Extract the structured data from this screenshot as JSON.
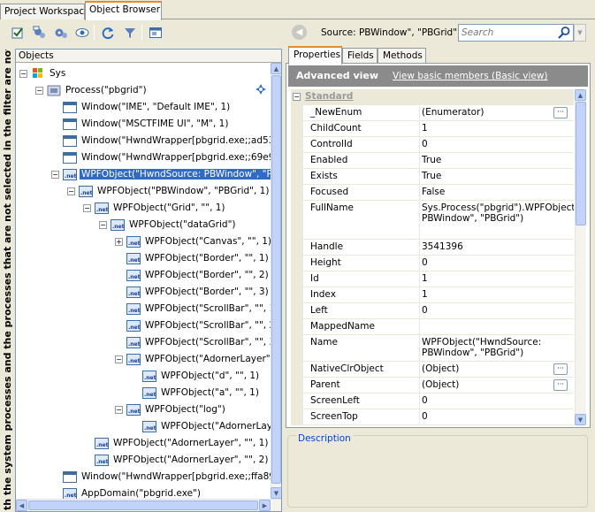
{
  "top_tabs": [
    {
      "label": "Project Workspace",
      "active": false
    },
    {
      "label": "Object Browser",
      "active": true
    }
  ],
  "toolbar": {
    "icons": [
      "checkbox-icon",
      "processes-icon",
      "gears-icon",
      "eye-icon",
      "refresh-icon",
      "filter-icon",
      "window-icon"
    ]
  },
  "source": {
    "label": "Source: PBWindow\", \"PBGrid\")"
  },
  "search": {
    "placeholder": "Search"
  },
  "side_text": "th the system processes and the processes that are not selected in the filter are not displayed",
  "objects_header": "Objects",
  "tree": [
    {
      "label": "Sys",
      "icon": "sys-icon",
      "expander": "-"
    },
    {
      "label": "Process(\"pbgrid\")",
      "icon": "process-icon",
      "expander": "-"
    },
    {
      "label": "Window(\"IME\", \"Default IME\", 1)",
      "icon": "window-icon",
      "expander": ""
    },
    {
      "label": "Window(\"MSCTFIME UI\", \"M\", 1)",
      "icon": "window-icon",
      "expander": ""
    },
    {
      "label": "Window(\"HwndWrapper[pbgrid.exe;;ad53e",
      "icon": "window-icon",
      "expander": ""
    },
    {
      "label": "Window(\"HwndWrapper[pbgrid.exe;;69e90",
      "icon": "window-icon",
      "expander": ""
    },
    {
      "label": "WPFObject(\"HwndSource: PBWindow\", \"PB",
      "icon": "net-icon",
      "expander": "-",
      "selected": true
    },
    {
      "label": "WPFObject(\"PBWindow\", \"PBGrid\", 1)",
      "icon": "net-icon",
      "expander": "-"
    },
    {
      "label": "WPFObject(\"Grid\", \"\", 1)",
      "icon": "net-icon",
      "expander": "-"
    },
    {
      "label": "WPFObject(\"dataGrid\")",
      "icon": "net-icon",
      "expander": "-"
    },
    {
      "label": "WPFObject(\"Canvas\", \"\", 1)",
      "icon": "net-icon",
      "expander": "+"
    },
    {
      "label": "WPFObject(\"Border\", \"\", 1)",
      "icon": "net-icon",
      "expander": ""
    },
    {
      "label": "WPFObject(\"Border\", \"\", 2)",
      "icon": "net-icon",
      "expander": ""
    },
    {
      "label": "WPFObject(\"Border\", \"\", 3)",
      "icon": "net-icon",
      "expander": ""
    },
    {
      "label": "WPFObject(\"ScrollBar\", \"\", 1",
      "icon": "net-icon",
      "expander": ""
    },
    {
      "label": "WPFObject(\"ScrollBar\", \"\", 2",
      "icon": "net-icon",
      "expander": ""
    },
    {
      "label": "WPFObject(\"ScrollBar\", \"\", 3",
      "icon": "net-icon",
      "expander": ""
    },
    {
      "label": "WPFObject(\"AdornerLayer\"",
      "icon": "net-icon",
      "expander": "-"
    },
    {
      "label": "WPFObject(\"d\", \"\", 1)",
      "icon": "net-icon",
      "expander": ""
    },
    {
      "label": "WPFObject(\"a\", \"\", 1)",
      "icon": "net-icon",
      "expander": ""
    },
    {
      "label": "WPFObject(\"log\")",
      "icon": "net-icon",
      "expander": "-"
    },
    {
      "label": "WPFObject(\"AdornerLayer\"",
      "icon": "net-icon",
      "expander": ""
    },
    {
      "label": "WPFObject(\"AdornerLayer\", \"\", 1)",
      "icon": "net-icon",
      "expander": ""
    },
    {
      "label": "WPFObject(\"AdornerLayer\", \"\", 2)",
      "icon": "net-icon",
      "expander": ""
    },
    {
      "label": "Window(\"HwndWrapper[pbgrid.exe;;ffa89c",
      "icon": "window-icon",
      "expander": ""
    },
    {
      "label": "AppDomain(\"pbgrid.exe\")",
      "icon": "net-icon",
      "expander": ""
    }
  ],
  "prop_tabs": [
    {
      "label": "Properties",
      "active": true
    },
    {
      "label": "Fields",
      "active": false
    },
    {
      "label": "Methods",
      "active": false
    }
  ],
  "advanced": {
    "title": "Advanced view",
    "link": "View basic members (Basic view)"
  },
  "category": "Standard",
  "properties": [
    {
      "name": "_NewEnum",
      "value": "(Enumerator)",
      "button": true
    },
    {
      "name": "ChildCount",
      "value": "1",
      "button": false
    },
    {
      "name": "ControlId",
      "value": "0",
      "button": false
    },
    {
      "name": "Enabled",
      "value": "True",
      "button": false
    },
    {
      "name": "Exists",
      "value": "True",
      "button": false
    },
    {
      "name": "Focused",
      "value": "False",
      "button": false
    },
    {
      "name": "FullName",
      "value": "Sys.Process(\"pbgrid\").WPFObject(\"HwndSource: PBWindow\", \"PBGrid\")",
      "button": false
    },
    {
      "name": "Handle",
      "value": "3541396",
      "button": false
    },
    {
      "name": "Height",
      "value": "0",
      "button": false
    },
    {
      "name": "Id",
      "value": "1",
      "button": false
    },
    {
      "name": "Index",
      "value": "1",
      "button": false
    },
    {
      "name": "Left",
      "value": "0",
      "button": false
    },
    {
      "name": "MappedName",
      "value": "",
      "button": false
    },
    {
      "name": "Name",
      "value": "WPFObject(\"HwndSource: PBWindow\", \"PBGrid\")",
      "button": false
    },
    {
      "name": "NativeClrObject",
      "value": "(Object)",
      "button": true
    },
    {
      "name": "Parent",
      "value": "(Object)",
      "button": true
    },
    {
      "name": "ScreenLeft",
      "value": "0",
      "button": false
    },
    {
      "name": "ScreenTop",
      "value": "0",
      "button": false
    }
  ],
  "description_label": "Description",
  "colors": {
    "selection": "#316ac5",
    "tab_accent": "#e68b2c",
    "advanced_bar": "#8b8b8b",
    "description_text": "#0046d5"
  }
}
